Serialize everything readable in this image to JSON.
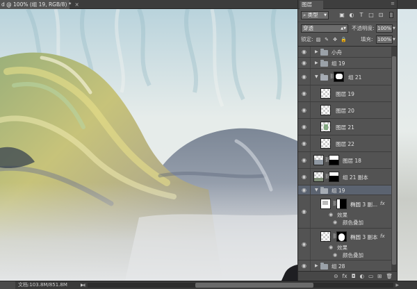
{
  "document": {
    "tab_title": "d @ 100% (组 19, RGB/8) *",
    "tab_close": "×"
  },
  "status": {
    "zoom": "",
    "doc_size": "文档:103.8M/851.8M",
    "arrow": "▶"
  },
  "panel": {
    "tab": "图层",
    "menu_icon": "≡",
    "filter": {
      "label": "类型",
      "icons": [
        "image-icon",
        "adjustment-icon",
        "text-icon",
        "shape-icon",
        "smart-object-icon"
      ],
      "icon_glyphs": [
        "▣",
        "◐",
        "T",
        "□",
        "⊡"
      ]
    },
    "blend_mode": "穿透",
    "opacity_label": "不透明度:",
    "opacity_value": "100%",
    "lock_label": "锁定:",
    "lock_glyphs": [
      "▨",
      "✎",
      "✥",
      "🔒"
    ],
    "fill_label": "填充:",
    "fill_value": "100%",
    "layers": [
      {
        "name": "小舟",
        "type": "group",
        "expanded": false
      },
      {
        "name": "组 19",
        "type": "group",
        "expanded": false
      },
      {
        "name": "组 21",
        "type": "group",
        "expanded": true,
        "mask": true
      },
      {
        "name": "图层 19",
        "type": "layer"
      },
      {
        "name": "图层 20",
        "type": "layer"
      },
      {
        "name": "图层 21",
        "type": "layer"
      },
      {
        "name": "图层 22",
        "type": "layer"
      },
      {
        "name": "图层 18",
        "type": "layer",
        "mask": true
      },
      {
        "name": "组 21 副本",
        "type": "layer",
        "mask": true
      },
      {
        "name": "组 19",
        "type": "group",
        "expanded": true,
        "selected": true
      },
      {
        "name": "椭圆 3 副...",
        "type": "layer",
        "mask": true,
        "fx": "fx",
        "effects_label": "效果",
        "effect": "颜色叠加"
      },
      {
        "name": "椭圆 3 副本",
        "type": "layer",
        "mask": true,
        "fx": "fx",
        "effects_label": "效果",
        "effect": "颜色叠加"
      },
      {
        "name": "组 28",
        "type": "group",
        "expanded": false
      }
    ],
    "bottom_icons": [
      "link-icon",
      "fx-icon",
      "mask-icon",
      "adjustment-icon",
      "group-icon",
      "new-layer-icon",
      "trash-icon"
    ],
    "bottom_glyphs": [
      "⊝",
      "fx",
      "◘",
      "◐",
      "▭",
      "⊞",
      "🗑"
    ]
  }
}
